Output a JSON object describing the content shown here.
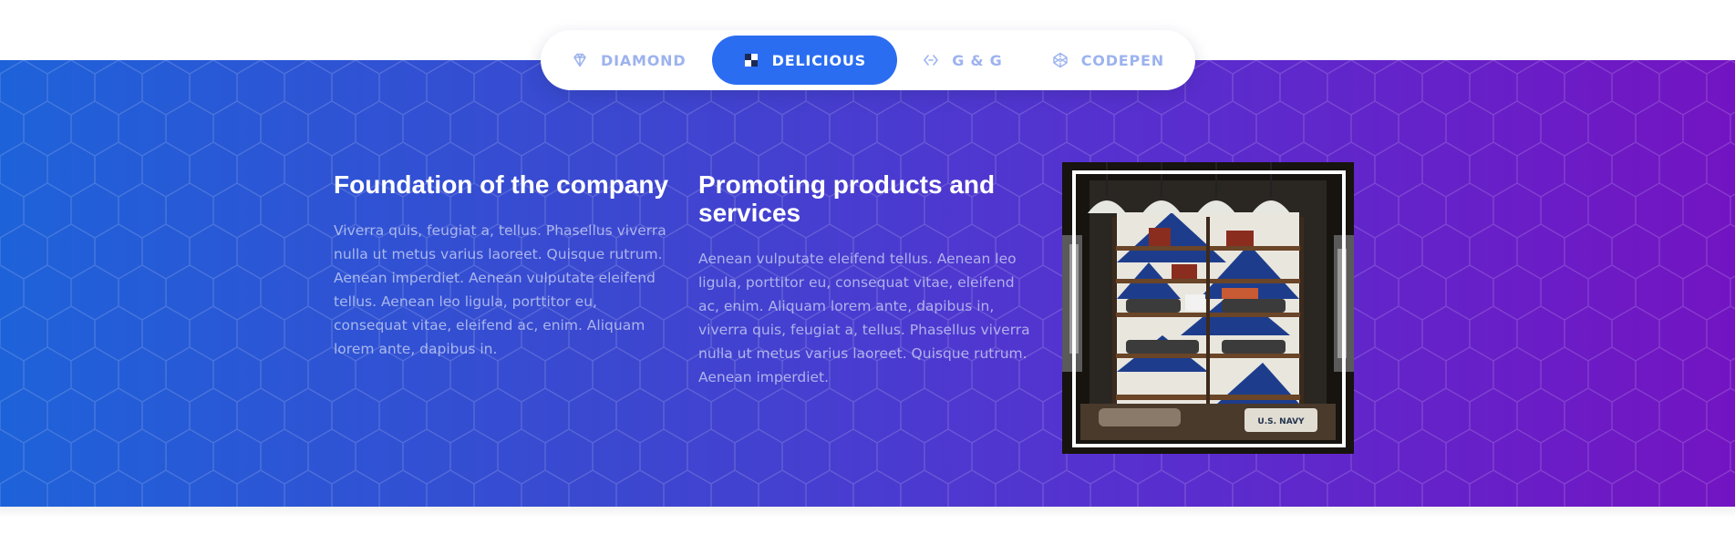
{
  "tabs": [
    {
      "label": "DIAMOND",
      "icon": "diamond-icon",
      "active": false
    },
    {
      "label": "DELICIOUS",
      "icon": "delicious-icon",
      "active": true
    },
    {
      "label": "G & G",
      "icon": "code-icon",
      "active": false
    },
    {
      "label": "CODEPEN",
      "icon": "codepen-icon",
      "active": false
    }
  ],
  "columns": [
    {
      "title": "Foundation of the company",
      "text": "Viverra quis, feugiat a, tellus. Phasellus viverra nulla ut metus varius laoreet. Quisque rutrum. Aenean imperdiet. Aenean vulputate eleifend tellus. Aenean leo ligula, porttitor eu, consequat vitae, eleifend ac, enim. Aliquam lorem ante, dapibus in."
    },
    {
      "title": "Promoting products and services",
      "text": "Aenean vulputate eleifend tellus. Aenean leo ligula, porttitor eu, consequat vitae, eleifend ac, enim. Aliquam lorem ante, dapibus in, viverra quis, feugiat a, tellus. Phasellus viverra nulla ut metus varius laoreet. Quisque rutrum. Aenean imperdiet."
    }
  ],
  "photo": {
    "alt_sign": "U.S. NAVY"
  },
  "colors": {
    "gradient_start": "#1e62d9",
    "gradient_end": "#7314c2",
    "active_tab": "#2a6df1",
    "inactive_tab_text": "#9db3ee"
  }
}
